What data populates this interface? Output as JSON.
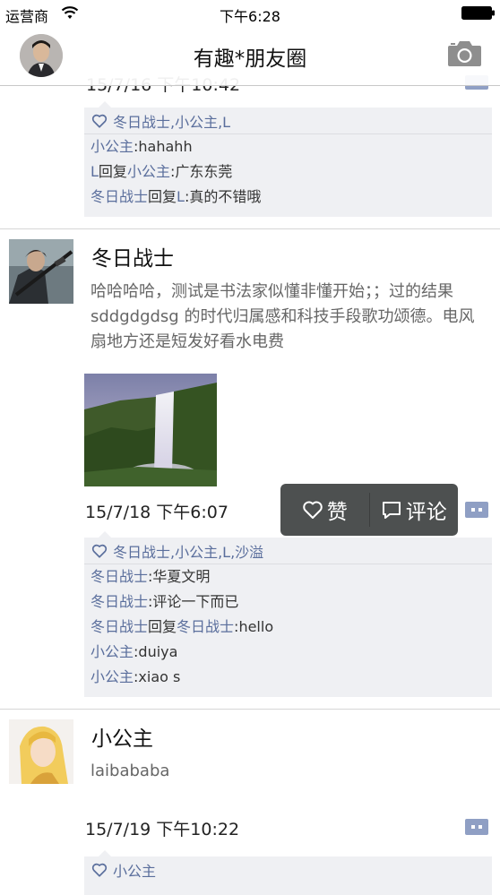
{
  "status_bar": {
    "carrier": "运营商",
    "time": "下午6:28"
  },
  "nav_bar": {
    "title": "有趣*朋友圈"
  },
  "top_partial_post": {
    "likes": "冬日战士,小公主,L",
    "comments": [
      {
        "name": "小公主",
        "reply_to": "",
        "text": ":hahahh"
      },
      {
        "name": "L",
        "reply_to": "小公主",
        "text": ":广东东莞"
      },
      {
        "name": "冬日战士",
        "reply_to": "L",
        "text": ":真的不错哦"
      }
    ]
  },
  "posts": [
    {
      "author": "冬日战士",
      "text": "哈哈哈哈，测试是书法家似懂非懂开始；；过的结果 sddgdgdsg 的时代归属感和科技手段歌功颂德。电风扇地方还是短发好看水电费",
      "time": "15/7/18 下午6:07",
      "likes": "冬日战士,小公主,L,沙溢",
      "comments": [
        {
          "name": "冬日战士",
          "reply_to": "",
          "text": ":华夏文明"
        },
        {
          "name": "冬日战士",
          "reply_to": "",
          "text": ":评论一下而已"
        },
        {
          "name": "冬日战士",
          "reply_to": "冬日战士",
          "text": ":hello"
        },
        {
          "name": "小公主",
          "reply_to": "",
          "text": ":duiya"
        },
        {
          "name": "小公主",
          "reply_to": "",
          "text": ":xiao s"
        }
      ]
    },
    {
      "author": "小公主",
      "text": "laibababa",
      "time": "15/7/19 下午10:22",
      "likes": "小公主",
      "comments": []
    }
  ],
  "action_popup": {
    "like_label": "赞",
    "comment_label": "评论"
  },
  "reply_word": "回复",
  "icons": [
    "wifi-icon",
    "battery-icon",
    "camera-icon",
    "heart-icon",
    "comment-icon",
    "more-bubble-icon"
  ],
  "colors": {
    "name_link": "#5a6e9c",
    "interaction_bg": "#eff0f3",
    "popup_bg": "#4d5050",
    "bubble": "#8f9fc4"
  }
}
